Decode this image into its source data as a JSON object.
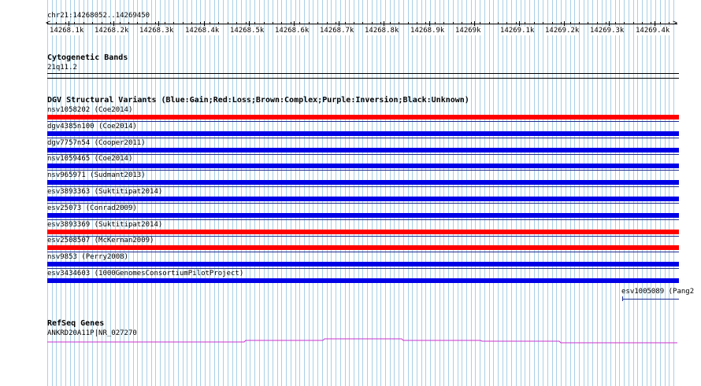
{
  "window": {
    "region": "chr21:14268052..14269450"
  },
  "ruler": {
    "ticks": [
      "14268.1k",
      "14268.2k",
      "14268.3k",
      "14268.4k",
      "14268.5k",
      "14268.6k",
      "14268.7k",
      "14268.8k",
      "14268.9k",
      "14269k",
      "14269.1k",
      "14269.2k",
      "14269.3k",
      "14269.4k"
    ]
  },
  "cytobands": {
    "title": "Cytogenetic Bands",
    "band": "21q11.2"
  },
  "dgv": {
    "title": "DGV Structural Variants (Blue:Gain;Red:Loss;Brown:Complex;Purple:Inversion;Black:Unknown)",
    "variants": [
      {
        "label": "nsv1058202 (Coe2014)",
        "type": "loss"
      },
      {
        "label": "dgv4385n100 (Coe2014)",
        "type": "gain"
      },
      {
        "label": "dgv7757n54 (Cooper2011)",
        "type": "gain"
      },
      {
        "label": "nsv1059465 (Coe2014)",
        "type": "gain"
      },
      {
        "label": "nsv965971 (Sudmant2013)",
        "type": "gain"
      },
      {
        "label": "esv3893363 (Suktitipat2014)",
        "type": "gain"
      },
      {
        "label": "esv25073 (Conrad2009)",
        "type": "gain"
      },
      {
        "label": "esv3893369 (Suktitipat2014)",
        "type": "loss"
      },
      {
        "label": "esv2508507 (McKernan2009)",
        "type": "loss"
      },
      {
        "label": "nsv9853 (Perry2008)",
        "type": "gain"
      },
      {
        "label": "esv3434603 (1000GenomesConsortiumPilotProject)",
        "type": "gain"
      }
    ],
    "partial_variant": {
      "label": "esv1005089 (Pang2"
    }
  },
  "refseq": {
    "title": "RefSeq Genes",
    "gene": "ANKRD20A11P|NR_027270"
  },
  "colors": {
    "gain": "#0000e6",
    "loss": "#ff0000",
    "grid": "#a9d0e6",
    "separator": "#1f2b8f",
    "gene_line": "#cc33cc"
  }
}
